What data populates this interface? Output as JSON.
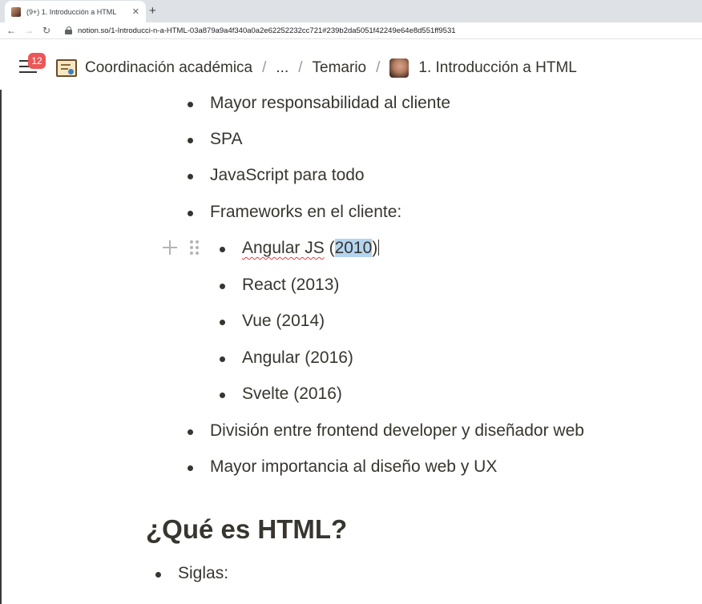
{
  "browser": {
    "tab_title": "(9+) 1. Introducción a HTML",
    "tab_close": "✕",
    "new_tab": "+",
    "url": "notion.so/1-Introducci-n-a-HTML-03a879a9a4f340a0a2e62252232cc721#239b2da5051f42249e64e8d551ff9531"
  },
  "topbar": {
    "notification_count": "12",
    "breadcrumbs": [
      {
        "label": "Coordinación académica",
        "icon": "certificate-icon"
      },
      {
        "label": "..."
      },
      {
        "label": "Temario"
      },
      {
        "label": "1. Introducción a HTML",
        "icon": "avatar-icon"
      }
    ],
    "separator": "/"
  },
  "content": {
    "bullets_top": [
      "Mayor responsabilidad al cliente",
      "SPA",
      "JavaScript para todo",
      "Frameworks en el cliente:"
    ],
    "frameworks": {
      "angularjs": {
        "name": "Angular JS",
        "open": " (",
        "year": "2010",
        "close": ")"
      },
      "others": [
        "React (2013)",
        "Vue (2014)",
        "Angular (2016)",
        "Svelte (2016)"
      ]
    },
    "bullets_after": [
      "División entre frontend developer y diseñador web",
      "Mayor importancia al diseño web y UX"
    ],
    "heading": "¿Qué es HTML?",
    "section_bullets": [
      "Siglas:"
    ]
  }
}
